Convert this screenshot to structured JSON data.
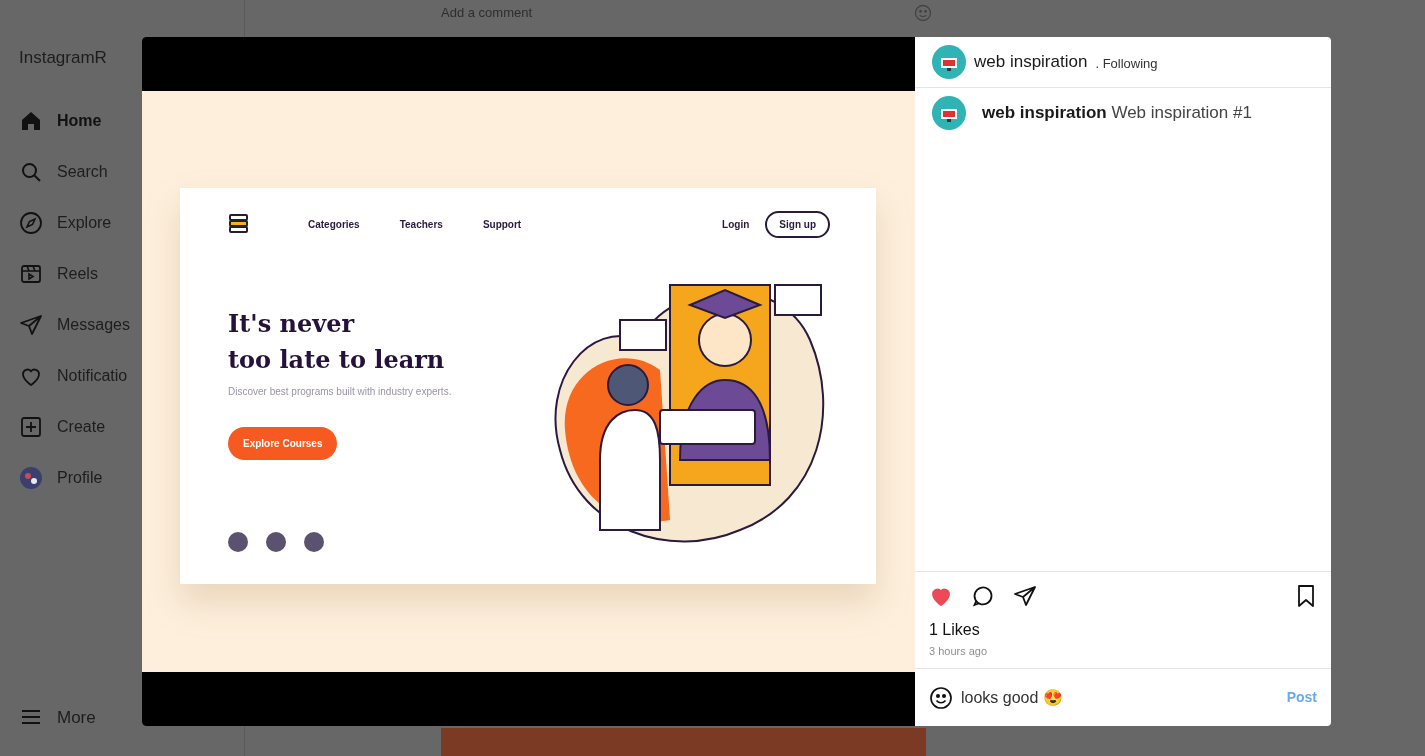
{
  "sidebar": {
    "logo": "InstagramR",
    "items": [
      {
        "label": "Home",
        "selected": true
      },
      {
        "label": "Search",
        "selected": false
      },
      {
        "label": "Explore",
        "selected": false
      },
      {
        "label": "Reels",
        "selected": false
      },
      {
        "label": "Messages",
        "selected": false
      },
      {
        "label": "Notificatio",
        "selected": false
      },
      {
        "label": "Create",
        "selected": false
      },
      {
        "label": "Profile",
        "selected": false
      }
    ],
    "more": "More"
  },
  "feed": {
    "comment_placeholder": "Add a comment"
  },
  "modal": {
    "post_image": {
      "nav": [
        "Categories",
        "Teachers",
        "Support"
      ],
      "login": "Login",
      "signup": "Sign up",
      "headline_1": "It's never",
      "headline_2": "too late to learn",
      "subtitle": "Discover best programs built with industry experts.",
      "cta": "Explore Courses"
    },
    "header": {
      "username": "web inspiration",
      "follow_status": ". Following"
    },
    "caption": {
      "username": "web inspiration",
      "text": "Web inspiration #1"
    },
    "actions": {
      "liked": true,
      "saved": false
    },
    "likes": "1 Likes",
    "time": "3 hours ago",
    "comment_field": {
      "value": "looks good 😍",
      "post": "Post"
    }
  }
}
